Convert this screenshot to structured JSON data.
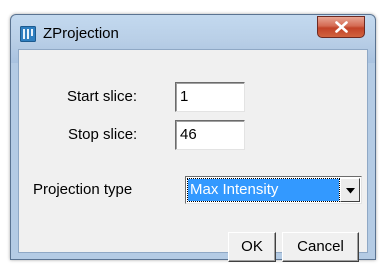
{
  "window": {
    "title": "ZProjection",
    "icon": "imagej-app-icon",
    "close_icon": "close-x-icon"
  },
  "form": {
    "start_slice_label": "Start slice:",
    "start_slice_value": "1",
    "stop_slice_label": "Stop slice:",
    "stop_slice_value": "46",
    "projection_type_label": "Projection type",
    "projection_type_value": "Max Intensity"
  },
  "buttons": {
    "ok_label": "OK",
    "cancel_label": "Cancel"
  },
  "colors": {
    "selection": "#3399ff",
    "close_button": "#c24328",
    "dialog_background": "#f0f0f0"
  }
}
